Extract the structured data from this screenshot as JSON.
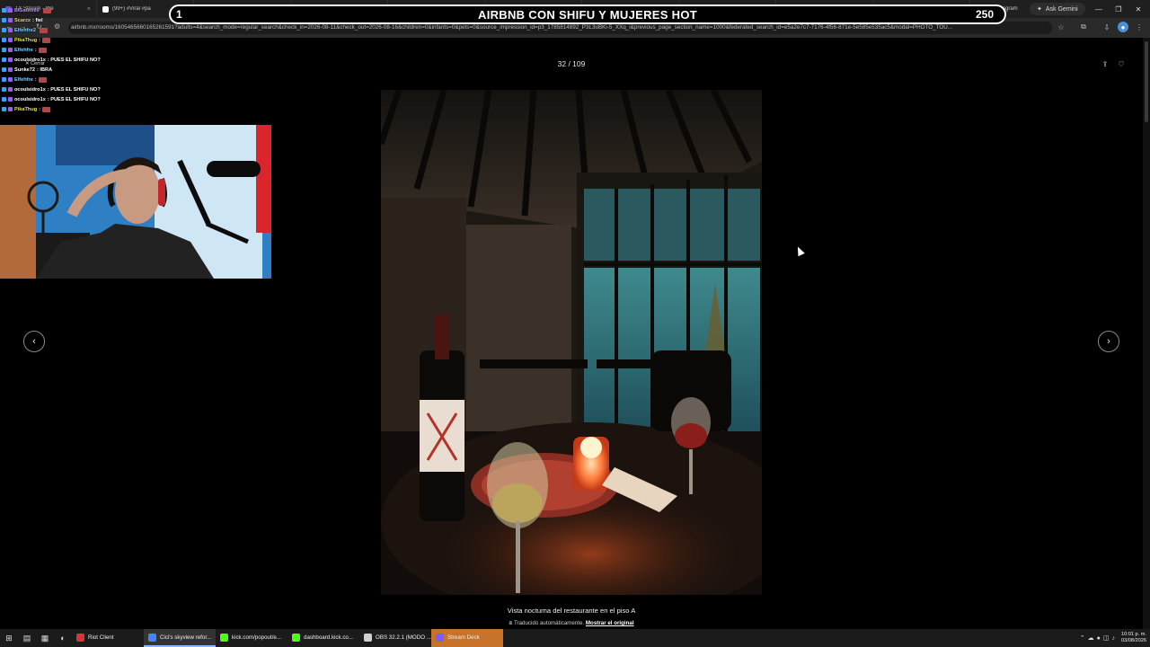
{
  "browser": {
    "tabs": [
      {
        "label": "1X Stream - We",
        "color": "#6a4ccf"
      },
      {
        "label": "(99+) #Viral #pa",
        "color": "#ffffff"
      },
      {
        "label": "TikTok",
        "color": "#ffffff"
      },
      {
        "label": "(394) JUEGO DE CUBITOS",
        "color": "#e62117"
      },
      {
        "label": "Inicio / X",
        "color": "#dddddd"
      },
      {
        "label": "Airbnb | Ciudad de México",
        "color": "#ff385c"
      },
      {
        "label": "Cici's skyview reforma",
        "color": "#ff385c"
      },
      {
        "label": "Penthouse de Lujo | Terraza",
        "color": "#ff385c"
      },
      {
        "label": "Penthouse de Lujo | Terraza",
        "color": "#ff385c"
      },
      {
        "label": "Widgets | BotRix — Cloud",
        "color": "#cccccc"
      },
      {
        "label": "(9) Instagram",
        "color": "#d6249f"
      }
    ],
    "ask_gemini": "Ask Gemini",
    "url": "airbnb.mx/rooms/1605465660165261591?adults=4&search_mode=regular_search&check_in=2026-08-11&check_out=2026-08-16&children=0&infants=0&pets=0&source_impression_id=p3_1785814892_P3L3oBKi-5_XXq_i&previous_page_section_name=1000&federated_search_id=e5a2e7c7-7176-4f56-871e-5e585e535ac5&modal=PHOTO_TOU..."
  },
  "overlay": {
    "banner_title": "AIRBNB CON SHIFU Y MUJERES HOT",
    "banner_left": "1",
    "banner_right": "250",
    "close_label": "Cerrar"
  },
  "chat": [
    {
      "user": "ElGatito69",
      "text": "",
      "color": "#b08fe8"
    },
    {
      "user": "Scarzx",
      "text": ": fiel",
      "color": "#f0d060"
    },
    {
      "user": "Elfehfre2",
      "text": "",
      "color": "#7fd0ff"
    },
    {
      "user": "PikaThug",
      "text": ":",
      "color": "#e6e64a"
    },
    {
      "user": "Elfehfre",
      "text": ":",
      "color": "#7fd0ff"
    },
    {
      "user": "ocoulsidro1x",
      "text": ": PUES EL SHIFU NO?",
      "color": "#ffffff"
    },
    {
      "user": "Sunke72",
      "text": ": IBRA",
      "color": "#ffffff"
    },
    {
      "user": "Elfehfre",
      "text": ":",
      "color": "#7fd0ff"
    },
    {
      "user": "ocoulsidro1x",
      "text": ": PUES EL SHIFU NO?",
      "color": "#ffffff"
    },
    {
      "user": "ocoulsidro1x",
      "text": ": PUES EL SHIFU NO?",
      "color": "#ffffff"
    },
    {
      "user": "PikaThug",
      "text": ":",
      "color": "#e6e64a"
    }
  ],
  "viewer": {
    "counter": "32 / 109",
    "caption": "Vista nocturna del restaurante en el piso A",
    "translated": "Traducido automáticamente.",
    "show_original": "Mostrar el original"
  },
  "taskbar": {
    "apps": [
      {
        "label": "Riot Client",
        "color": "#d13639",
        "state": "normal"
      },
      {
        "label": "Cici's skyview refor...",
        "color": "#4285f4",
        "state": "active"
      },
      {
        "label": "kick.com/popout/e...",
        "color": "#53fc18",
        "state": "normal"
      },
      {
        "label": "dashboard.kick.co...",
        "color": "#53fc18",
        "state": "normal"
      },
      {
        "label": "OBS 32.2.1 (MODO ...",
        "color": "#cfcfcf",
        "state": "normal"
      },
      {
        "label": "Stream Deck",
        "color": "#7b5cff",
        "state": "stream"
      }
    ],
    "time": "10:01 p. m.",
    "date": "03/08/2026"
  },
  "colors": {
    "accent": "#ff385c",
    "background": "#000000"
  }
}
